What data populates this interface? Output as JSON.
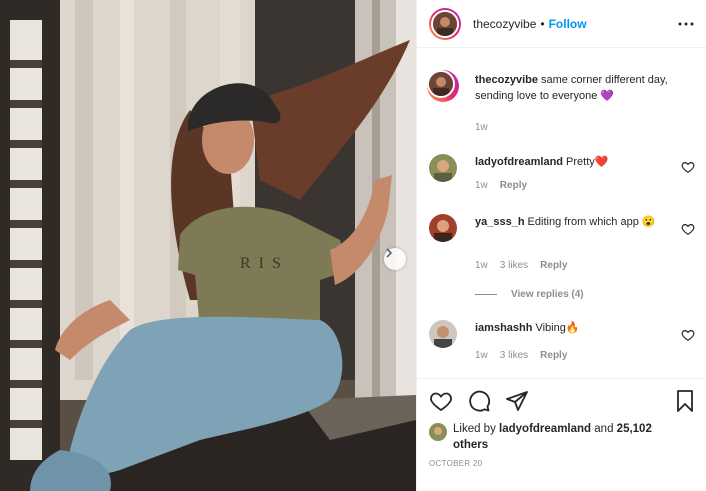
{
  "post": {
    "username": "thecozyvibe",
    "separator": "•",
    "follow_label": "Follow",
    "more_icon": "more-options-icon"
  },
  "caption": {
    "username": "thecozyvibe",
    "text": "same corner different day, sending love to everyone 💜",
    "time": "1w"
  },
  "comments": [
    {
      "username": "ladyofdreamland",
      "text": "Pretty❤️",
      "time": "1w",
      "likes": "",
      "reply_label": "Reply"
    },
    {
      "username": "ya_sss_h",
      "text": "Editing from which app 😮",
      "time": "1w",
      "likes": "3 likes",
      "reply_label": "Reply"
    },
    {
      "username": "iamshashh",
      "text": "Vibing🔥",
      "time": "1w",
      "likes": "3 likes",
      "reply_label": "Reply"
    }
  ],
  "view_replies_label": "View replies (4)",
  "likes": {
    "prefix": "Liked by",
    "user": "ladyofdreamland",
    "and": "and",
    "others": "25,102 others"
  },
  "date": "OCTOBER 20",
  "colors": {
    "follow": "#0095f6",
    "muted": "#8e8e8e",
    "text": "#262626"
  }
}
